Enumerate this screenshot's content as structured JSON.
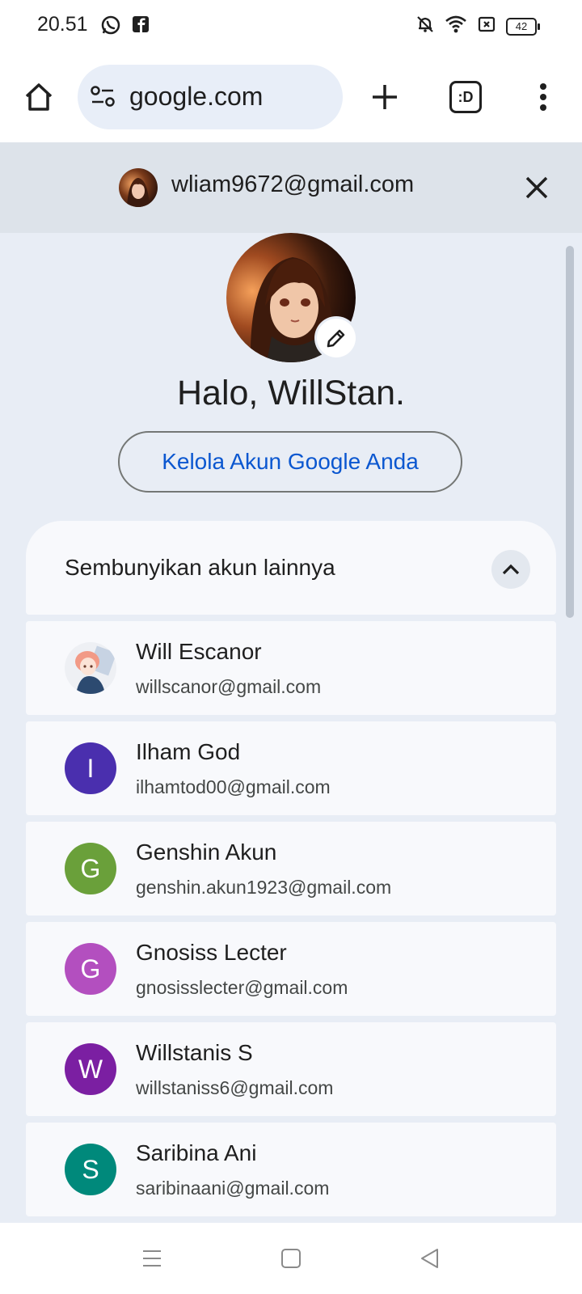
{
  "status_bar": {
    "time": "20.51",
    "battery": "42",
    "left_icons": [
      "whatsapp-icon",
      "facebook-icon"
    ],
    "right_icons": [
      "bell-off-icon",
      "wifi-icon",
      "sim-off-icon",
      "battery-icon"
    ]
  },
  "browser": {
    "url": "google.com",
    "tab_label": ":D"
  },
  "account_sheet": {
    "current_email": "wliam9672@gmail.com",
    "greeting": "Halo, WillStan.",
    "manage_button": "Kelola Akun Google Anda",
    "other_accounts_label": "Sembunyikan akun lainnya",
    "accounts": [
      {
        "name": "Will Escanor",
        "email": "willscanor@gmail.com",
        "initial": "",
        "color": "#f2d7cf"
      },
      {
        "name": "Ilham God",
        "email": "ilhamtod00@gmail.com",
        "initial": "I",
        "color": "#4a2fae"
      },
      {
        "name": "Genshin Akun",
        "email": "genshin.akun1923@gmail.com",
        "initial": "G",
        "color": "#6aa03a"
      },
      {
        "name": "Gnosiss Lecter",
        "email": "gnosisslecter@gmail.com",
        "initial": "G",
        "color": "#b34fbf"
      },
      {
        "name": "Willstanis S",
        "email": "willstaniss6@gmail.com",
        "initial": "W",
        "color": "#7b1fa2"
      },
      {
        "name": "Saribina Ani",
        "email": "saribinaani@gmail.com",
        "initial": "S",
        "color": "#00897b"
      }
    ]
  },
  "colors": {
    "accent": "#0b57d0",
    "sheet_bg": "#e8edf5",
    "header_bg": "#dde3ea"
  }
}
